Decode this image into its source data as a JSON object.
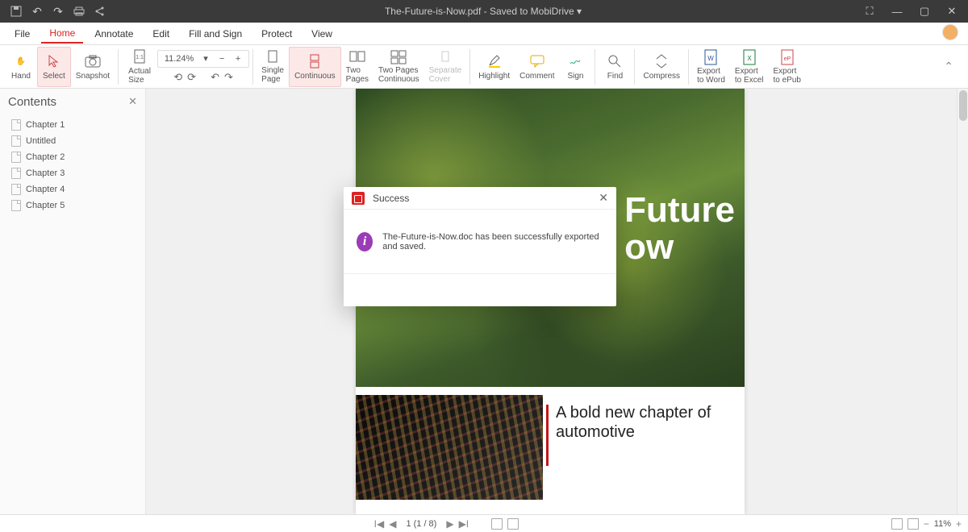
{
  "titlebar": {
    "text": "The-Future-is-Now.pdf - Saved to MobiDrive ▾"
  },
  "menu": {
    "file": "File",
    "home": "Home",
    "annotate": "Annotate",
    "edit": "Edit",
    "fill": "Fill and Sign",
    "protect": "Protect",
    "view": "View"
  },
  "toolbar": {
    "hand": "Hand",
    "select": "Select",
    "snapshot": "Snapshot",
    "actual": "Actual\nSize",
    "zoom_value": "11.24%",
    "single": "Single\nPage",
    "continuous": "Continuous",
    "two": "Two\nPages",
    "twocont": "Two Pages\nContinuous",
    "separate": "Separate\nCover",
    "highlight": "Highlight",
    "comment": "Comment",
    "sign": "Sign",
    "find": "Find",
    "compress": "Compress",
    "export_word": "Export\nto Word",
    "export_excel": "Export\nto Excel",
    "export_epub": "Export\nto ePub"
  },
  "sidebar": {
    "title": "Contents",
    "items": [
      {
        "label": "Chapter 1"
      },
      {
        "label": "Untitled"
      },
      {
        "label": "Chapter 2"
      },
      {
        "label": "Chapter 3"
      },
      {
        "label": "Chapter 4"
      },
      {
        "label": "Chapter 5"
      }
    ]
  },
  "page": {
    "hero": "Future\now",
    "body_heading": "A bold new chapter of automotive"
  },
  "dialog": {
    "title": "Success",
    "message": "The-Future-is-Now.doc has been successfully exported and saved."
  },
  "status": {
    "page_text": "1 (1 / 8)",
    "zoom": "11%"
  }
}
